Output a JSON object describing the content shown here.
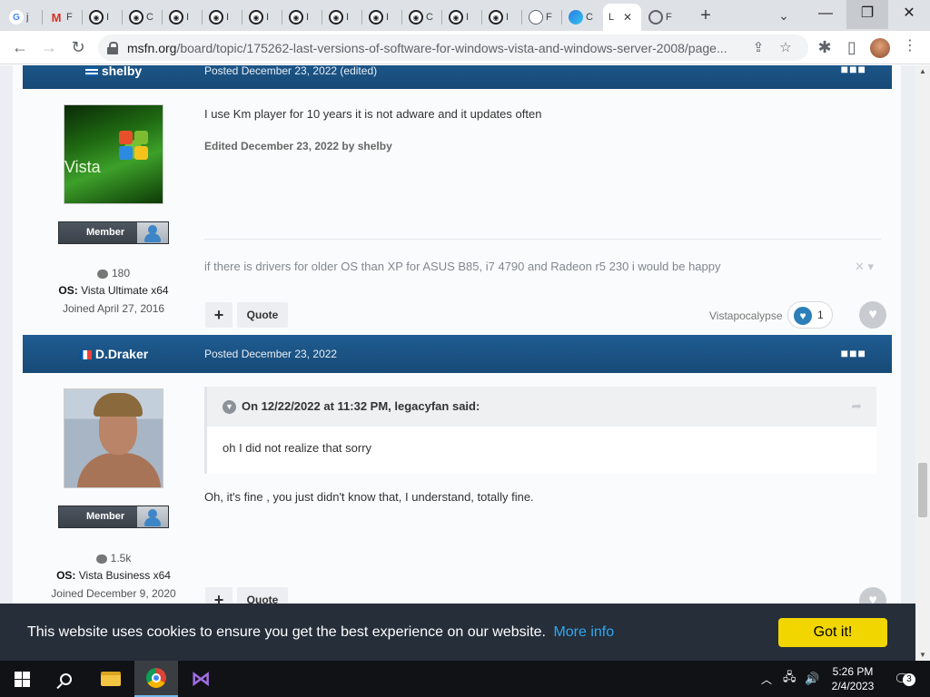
{
  "browser": {
    "tabs": [
      {
        "title": "j",
        "icon": "google-icon"
      },
      {
        "title": "F",
        "icon": "gmail-icon"
      },
      {
        "title": "I",
        "icon": "msfn-icon"
      },
      {
        "title": "C",
        "icon": "msfn-icon"
      },
      {
        "title": "I",
        "icon": "msfn-icon"
      },
      {
        "title": "I",
        "icon": "msfn-icon"
      },
      {
        "title": "I",
        "icon": "msfn-icon"
      },
      {
        "title": "I",
        "icon": "msfn-icon"
      },
      {
        "title": "I",
        "icon": "msfn-icon"
      },
      {
        "title": "I",
        "icon": "msfn-icon"
      },
      {
        "title": "C",
        "icon": "msfn-icon"
      },
      {
        "title": "I",
        "icon": "msfn-icon"
      },
      {
        "title": "I",
        "icon": "msfn-icon"
      },
      {
        "title": "F",
        "icon": "ghost-icon"
      },
      {
        "title": "C",
        "icon": "edge-icon"
      },
      {
        "title": "L",
        "icon": "none",
        "active": true
      },
      {
        "title": "F",
        "icon": "globe-icon"
      }
    ],
    "new_tab_label": "+",
    "url_host": "msfn.org",
    "url_path": "/board/topic/175262-last-versions-of-software-for-windows-vista-and-windows-server-2008/page...",
    "accent": "#1c5281"
  },
  "posts": [
    {
      "author": "shelby",
      "posted": "Posted December 23, 2022 (edited)",
      "body": "I use Km player for 10 years it is not adware and it updates often",
      "edited": "Edited December 23, 2022 by shelby",
      "badge": "Member",
      "avatar_text": "Vista",
      "post_count": "180",
      "os_label": "OS:",
      "os_value": "Vista Ultimate x64",
      "joined": "Joined April 27, 2016",
      "signature": "if there is drivers for older OS than XP for ASUS B85, i7 4790 and Radeon r5 230 i would be happy",
      "plus_label": "+",
      "quote_label": "Quote",
      "reactor": "Vistapocalypse",
      "reaction_count": "1"
    },
    {
      "author": "D.Draker",
      "posted": "Posted December 23, 2022",
      "quote_header": "On 12/22/2022 at 11:32 PM, legacyfan said:",
      "quote_text": "oh I did not realize that sorry",
      "body": "Oh, it's fine , you just didn't know that, I understand, totally fine.",
      "badge": "Member",
      "post_count": "1.5k",
      "os_label": "OS:",
      "os_value": "Vista Business x64",
      "joined": "Joined December 9, 2020",
      "plus_label": "+",
      "quote_label": "Quote"
    }
  ],
  "cookie": {
    "text": "This website uses cookies to ensure you get the best experience on our website.",
    "more": "More info",
    "button": "Got it!"
  },
  "taskbar": {
    "time": "5:26 PM",
    "date": "2/4/2023",
    "notification_count": "3"
  }
}
